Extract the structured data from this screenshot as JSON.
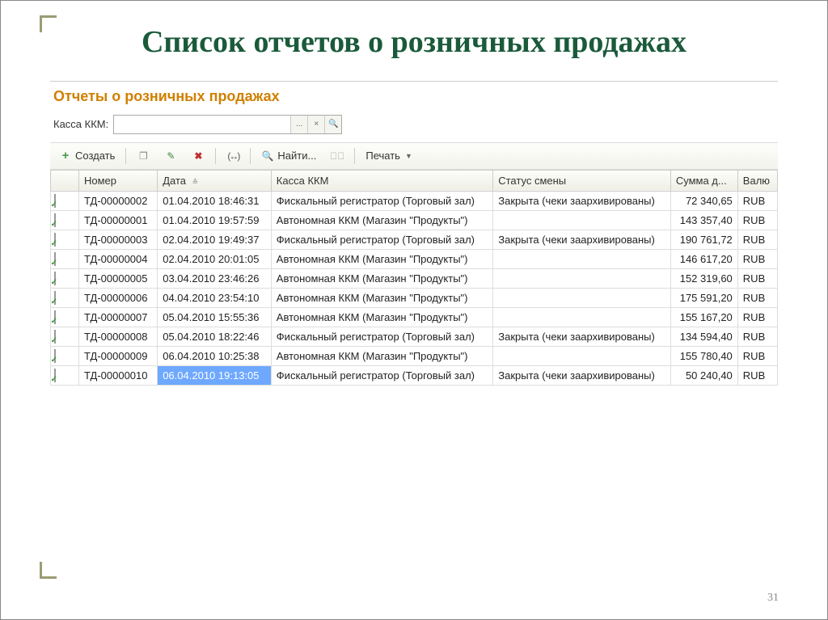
{
  "slide": {
    "title": "Список отчетов о розничных продажах",
    "page_number": "31"
  },
  "window": {
    "title": "Отчеты о розничных продажах"
  },
  "filter": {
    "label": "Касса ККМ:",
    "value": "",
    "btn_select": "...",
    "btn_clear": "×",
    "btn_search_glyph": "🔍"
  },
  "toolbar": {
    "create": "Создать",
    "find": "Найти...",
    "print": "Печать"
  },
  "columns": {
    "number": "Номер",
    "date": "Дата",
    "kkm": "Касса ККМ",
    "shift_status": "Статус смены",
    "amount": "Сумма д...",
    "currency": "Валю"
  },
  "rows": [
    {
      "num": "ТД-00000002",
      "date": "01.04.2010 18:46:31",
      "kkm": "Фискальный регистратор (Торговый зал)",
      "status": "Закрыта (чеки заархивированы)",
      "amount": "72 340,65",
      "cur": "RUB"
    },
    {
      "num": "ТД-00000001",
      "date": "01.04.2010 19:57:59",
      "kkm": "Автономная ККМ (Магазин \"Продукты\")",
      "status": "",
      "amount": "143 357,40",
      "cur": "RUB"
    },
    {
      "num": "ТД-00000003",
      "date": "02.04.2010 19:49:37",
      "kkm": "Фискальный регистратор (Торговый зал)",
      "status": "Закрыта (чеки заархивированы)",
      "amount": "190 761,72",
      "cur": "RUB"
    },
    {
      "num": "ТД-00000004",
      "date": "02.04.2010 20:01:05",
      "kkm": "Автономная ККМ (Магазин \"Продукты\")",
      "status": "",
      "amount": "146 617,20",
      "cur": "RUB"
    },
    {
      "num": "ТД-00000005",
      "date": "03.04.2010 23:46:26",
      "kkm": "Автономная ККМ (Магазин \"Продукты\")",
      "status": "",
      "amount": "152 319,60",
      "cur": "RUB"
    },
    {
      "num": "ТД-00000006",
      "date": "04.04.2010 23:54:10",
      "kkm": "Автономная ККМ (Магазин \"Продукты\")",
      "status": "",
      "amount": "175 591,20",
      "cur": "RUB"
    },
    {
      "num": "ТД-00000007",
      "date": "05.04.2010 15:55:36",
      "kkm": "Автономная ККМ (Магазин \"Продукты\")",
      "status": "",
      "amount": "155 167,20",
      "cur": "RUB"
    },
    {
      "num": "ТД-00000008",
      "date": "05.04.2010 18:22:46",
      "kkm": "Фискальный регистратор (Торговый зал)",
      "status": "Закрыта (чеки заархивированы)",
      "amount": "134 594,40",
      "cur": "RUB"
    },
    {
      "num": "ТД-00000009",
      "date": "06.04.2010 10:25:38",
      "kkm": "Автономная ККМ (Магазин \"Продукты\")",
      "status": "",
      "amount": "155 780,40",
      "cur": "RUB"
    },
    {
      "num": "ТД-00000010",
      "date": "06.04.2010 19:13:05",
      "kkm": "Фискальный регистратор (Торговый зал)",
      "status": "Закрыта (чеки заархивированы)",
      "amount": "50 240,40",
      "cur": "RUB"
    }
  ],
  "selected_index": 9
}
